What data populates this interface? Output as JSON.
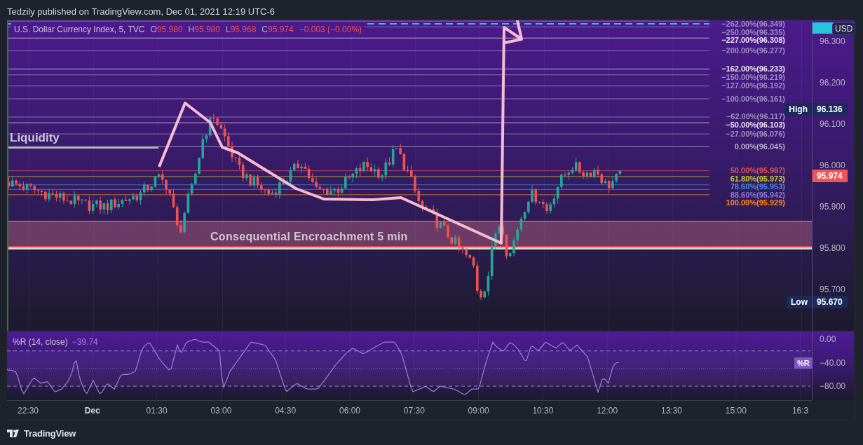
{
  "header": {
    "text": "Tedzily published on TradingView.com, Dec 01, 2021 12:19 UTC-6"
  },
  "chart": {
    "legend": {
      "symbol": "U.S. Dollar Currency Index, 5, TVC",
      "ohlc": [
        {
          "key": "O",
          "value": "95.980"
        },
        {
          "key": "H",
          "value": "95.980"
        },
        {
          "key": "L",
          "value": "95.968"
        },
        {
          "key": "C",
          "value": "95.974"
        }
      ],
      "change": "−0.003 (−0.00%)"
    },
    "liquidity_label": "Liquidity",
    "zone_label": "Consequential Encroachment 5 min",
    "fib_levels": [
      {
        "label": "−262.00%(96.349)",
        "color": "#9c8fc0"
      },
      {
        "label": "−250.00%(96.335)",
        "color": "#9c8fc0"
      },
      {
        "label": "−227.00%(96.308)",
        "color": "#e8e4f0"
      },
      {
        "label": "−200.00%(96.277)",
        "color": "#9c8fc0"
      },
      {
        "label": "−162.00%(96.233)",
        "color": "#e8e4f0"
      },
      {
        "label": "−150.00%(96.219)",
        "color": "#9c8fc0"
      },
      {
        "label": "−127.00%(96.192)",
        "color": "#9c8fc0"
      },
      {
        "label": "−100.00%(96.161)",
        "color": "#9c8fc0"
      },
      {
        "label": "−62.00%(96.117)",
        "color": "#9c8fc0"
      },
      {
        "label": "−50.00%(96.103)",
        "color": "#e8e4f0"
      },
      {
        "label": "−27.00%(96.076)",
        "color": "#9c8fc0"
      },
      {
        "label": "0.00%(96.045)",
        "color": "#b8b0d0"
      },
      {
        "label": "50.00%(95.987)",
        "color": "#e0525a"
      },
      {
        "label": "61.80%(95.973)",
        "color": "#c8c832"
      },
      {
        "label": "78.60%(95.953)",
        "color": "#4a90d9"
      },
      {
        "label": "88.60%(95.942)",
        "color": "#8a7ad8"
      },
      {
        "label": "100.00%(95.929)",
        "color": "#ff8c1a"
      }
    ],
    "price_axis": {
      "currency": "USD",
      "ticks": [
        "96.300",
        "96.200",
        "96.100",
        "96.000",
        "95.900",
        "95.800",
        "95.700"
      ],
      "last_price": "95.974",
      "high": {
        "label": "High",
        "value": "96.136"
      },
      "low": {
        "label": "Low",
        "value": "95.670"
      }
    },
    "indicator": {
      "title": "%R (14, close)",
      "value": "−39.74",
      "tag": "%R",
      "ticks": [
        "0.00",
        "−40.00",
        "−80.00"
      ]
    },
    "time_axis": [
      "22:30",
      "Dec",
      "01:30",
      "03:00",
      "04:30",
      "06:00",
      "07:30",
      "09:00",
      "10:30",
      "12:00",
      "13:30",
      "15:00",
      "16:3"
    ]
  },
  "footer": {
    "brand": "TradingView"
  }
}
